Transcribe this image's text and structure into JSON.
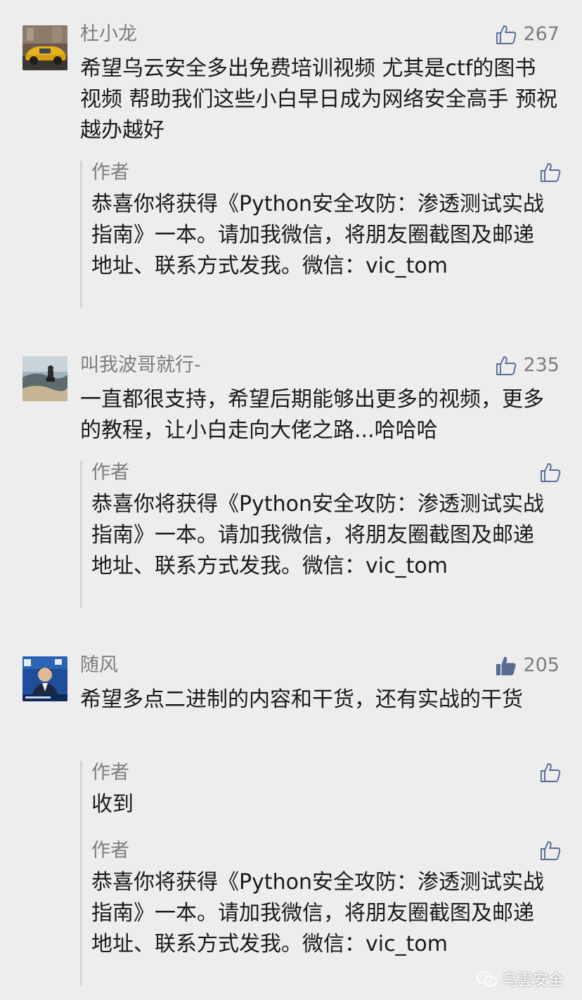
{
  "comments": [
    {
      "nickname": "杜小龙",
      "likes": "267",
      "liked": false,
      "content": "希望乌云安全多出免费培训视频 尤其是ctf的图书 视频 帮助我们这些小白早日成为网络安全高手 预祝越办越好",
      "replies": [
        {
          "author": "作者",
          "text": "恭喜你将获得《Python安全攻防：渗透测试实战指南》一本。请加我微信，将朋友圈截图及邮递地址、联系方式发我。微信：vic_tom"
        }
      ]
    },
    {
      "nickname": "叫我波哥就行-",
      "likes": "235",
      "liked": false,
      "content": "一直都很支持，希望后期能够出更多的视频，更多的教程，让小白走向大佬之路...哈哈哈",
      "replies": [
        {
          "author": "作者",
          "text": "恭喜你将获得《Python安全攻防：渗透测试实战指南》一本。请加我微信，将朋友圈截图及邮递地址、联系方式发我。微信：vic_tom"
        }
      ]
    },
    {
      "nickname": "随风",
      "likes": "205",
      "liked": true,
      "content": "希望多点二进制的内容和干货，还有实战的干货",
      "replies": [
        {
          "author": "作者",
          "text": "收到"
        },
        {
          "author": "作者",
          "text": "恭喜你将获得《Python安全攻防：渗透测试实战指南》一本。请加我微信，将朋友圈截图及邮递地址、联系方式发我。微信：vic_tom"
        }
      ]
    }
  ],
  "watermark": {
    "text": "乌雲安全",
    "icon": "wechat-icon"
  },
  "colors": {
    "background": "#ededed",
    "meta_text": "#7d7d7d",
    "body_text": "#1a1a1a",
    "thumb_liked": "#576b95",
    "reply_bar": "#d4d4d4"
  }
}
